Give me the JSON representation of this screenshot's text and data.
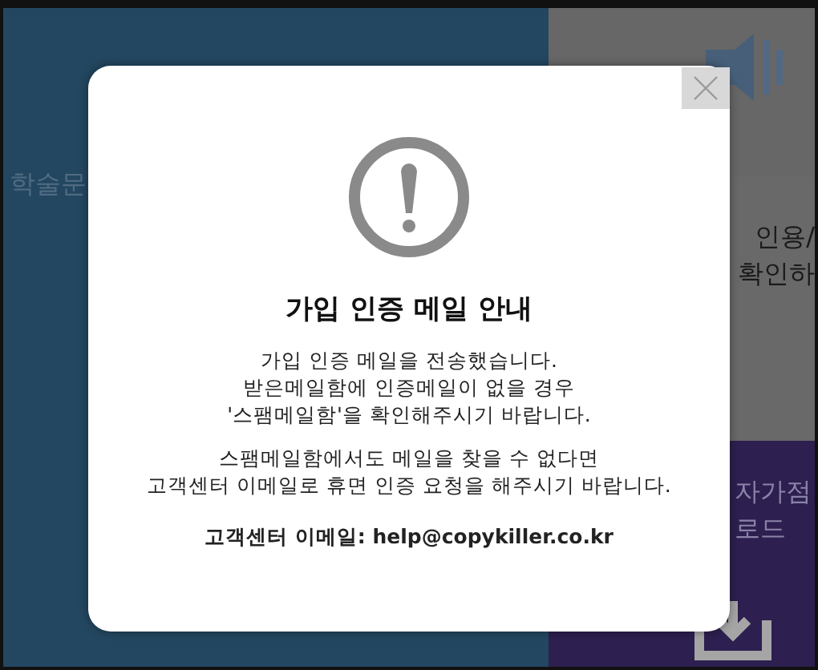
{
  "background": {
    "left_fragments": [
      "학술문"
    ],
    "right_fragments": [
      "인용/",
      "확인하",
      "자가점",
      "로드"
    ]
  },
  "dialog": {
    "title": "가입 인증 메일 안내",
    "paragraphs": [
      [
        "가입 인증 메일을 전송했습니다.",
        "받은메일함에 인증메일이 없을 경우",
        "'스팸메일함'을 확인해주시기 바랍니다."
      ],
      [
        "스팸메일함에서도 메일을 찾을 수 없다면",
        "고객센터 이메일로 휴면 인증 요청을 해주시기 바랍니다."
      ]
    ],
    "contact": "고객센터 이메일: help@copykiller.co.kr"
  }
}
